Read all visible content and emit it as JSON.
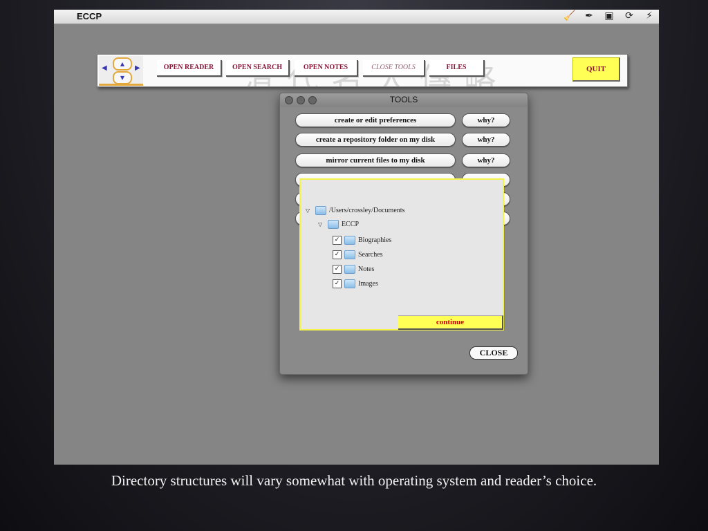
{
  "menubar": {
    "app_name": "ECCP",
    "tray_icons": [
      "broom-icon",
      "pen-icon",
      "window-icon",
      "sync-icon",
      "power-icon"
    ]
  },
  "toolbar": {
    "watermark": "清代名人傳略",
    "buttons": [
      "OPEN READER",
      "OPEN SEARCH",
      "OPEN NOTES",
      "CLOSE TOOLS",
      "FILES"
    ],
    "quit_label": "QUIT"
  },
  "tools": {
    "title": "TOOLS",
    "actions": [
      "create or edit preferences",
      "create a repository folder on my disk",
      "mirror current files to my disk"
    ],
    "why_label": "why?",
    "close_label": "CLOSE"
  },
  "dialog": {
    "root_path": "/Users/crossley/Documents",
    "app_folder": "ECCP",
    "subfolders": [
      "Biographies",
      "Searches",
      "Notes",
      "Images"
    ],
    "continue_label": "continue"
  },
  "caption": "Directory structures will vary somewhat with operating system and reader’s choice."
}
